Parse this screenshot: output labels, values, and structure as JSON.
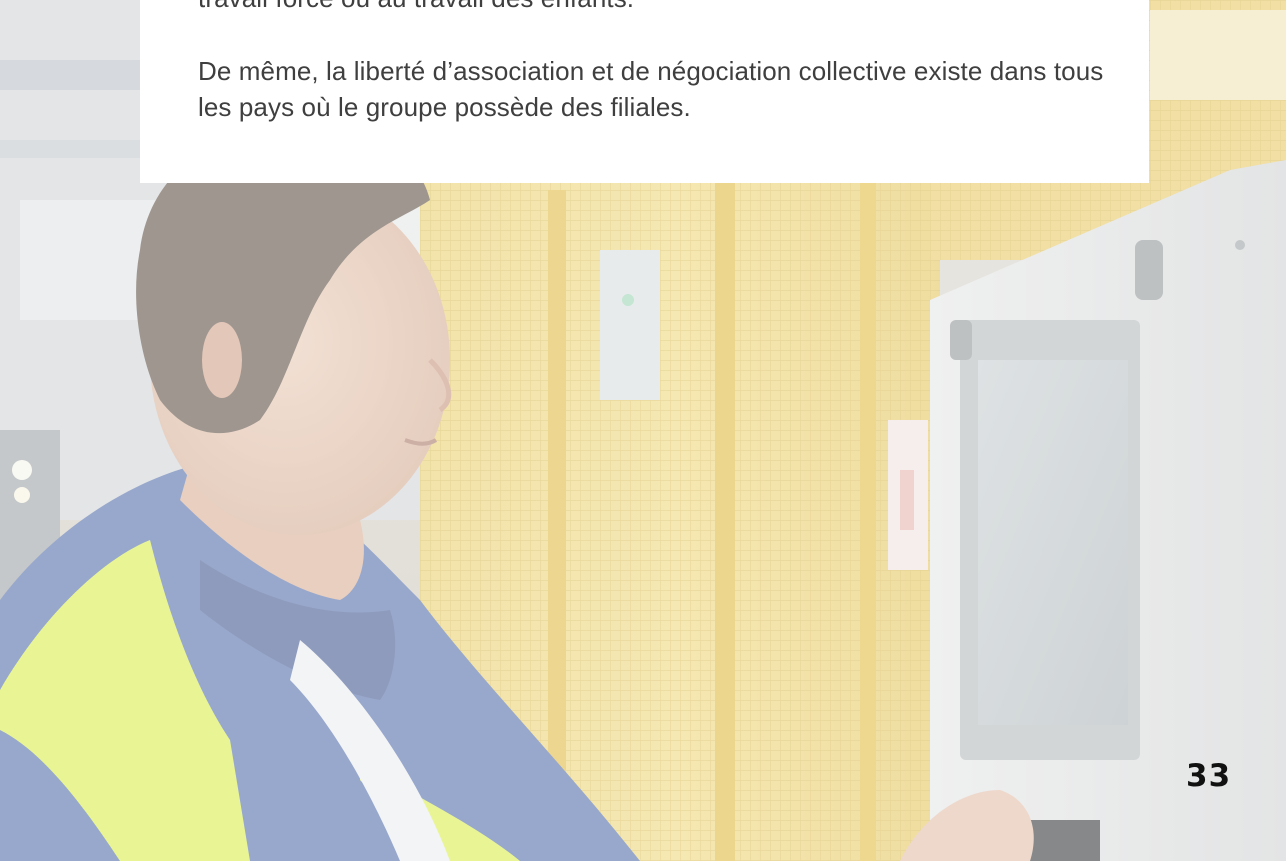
{
  "text_box": {
    "paragraph_1": "travail forcé ou au travail des enfants.",
    "paragraph_2": "De même, la liberté d’association et de négociation collective existe dans tous les pays où le groupe possède des filiales."
  },
  "page_number": "33",
  "colors": {
    "text": "#3f3f3f",
    "page_number": "#111111",
    "box_background": "#ffffff",
    "safety_yellow": "#f1d04a",
    "jacket_blue": "#4f6aa8",
    "hi_vis_green": "#d9ee48"
  }
}
